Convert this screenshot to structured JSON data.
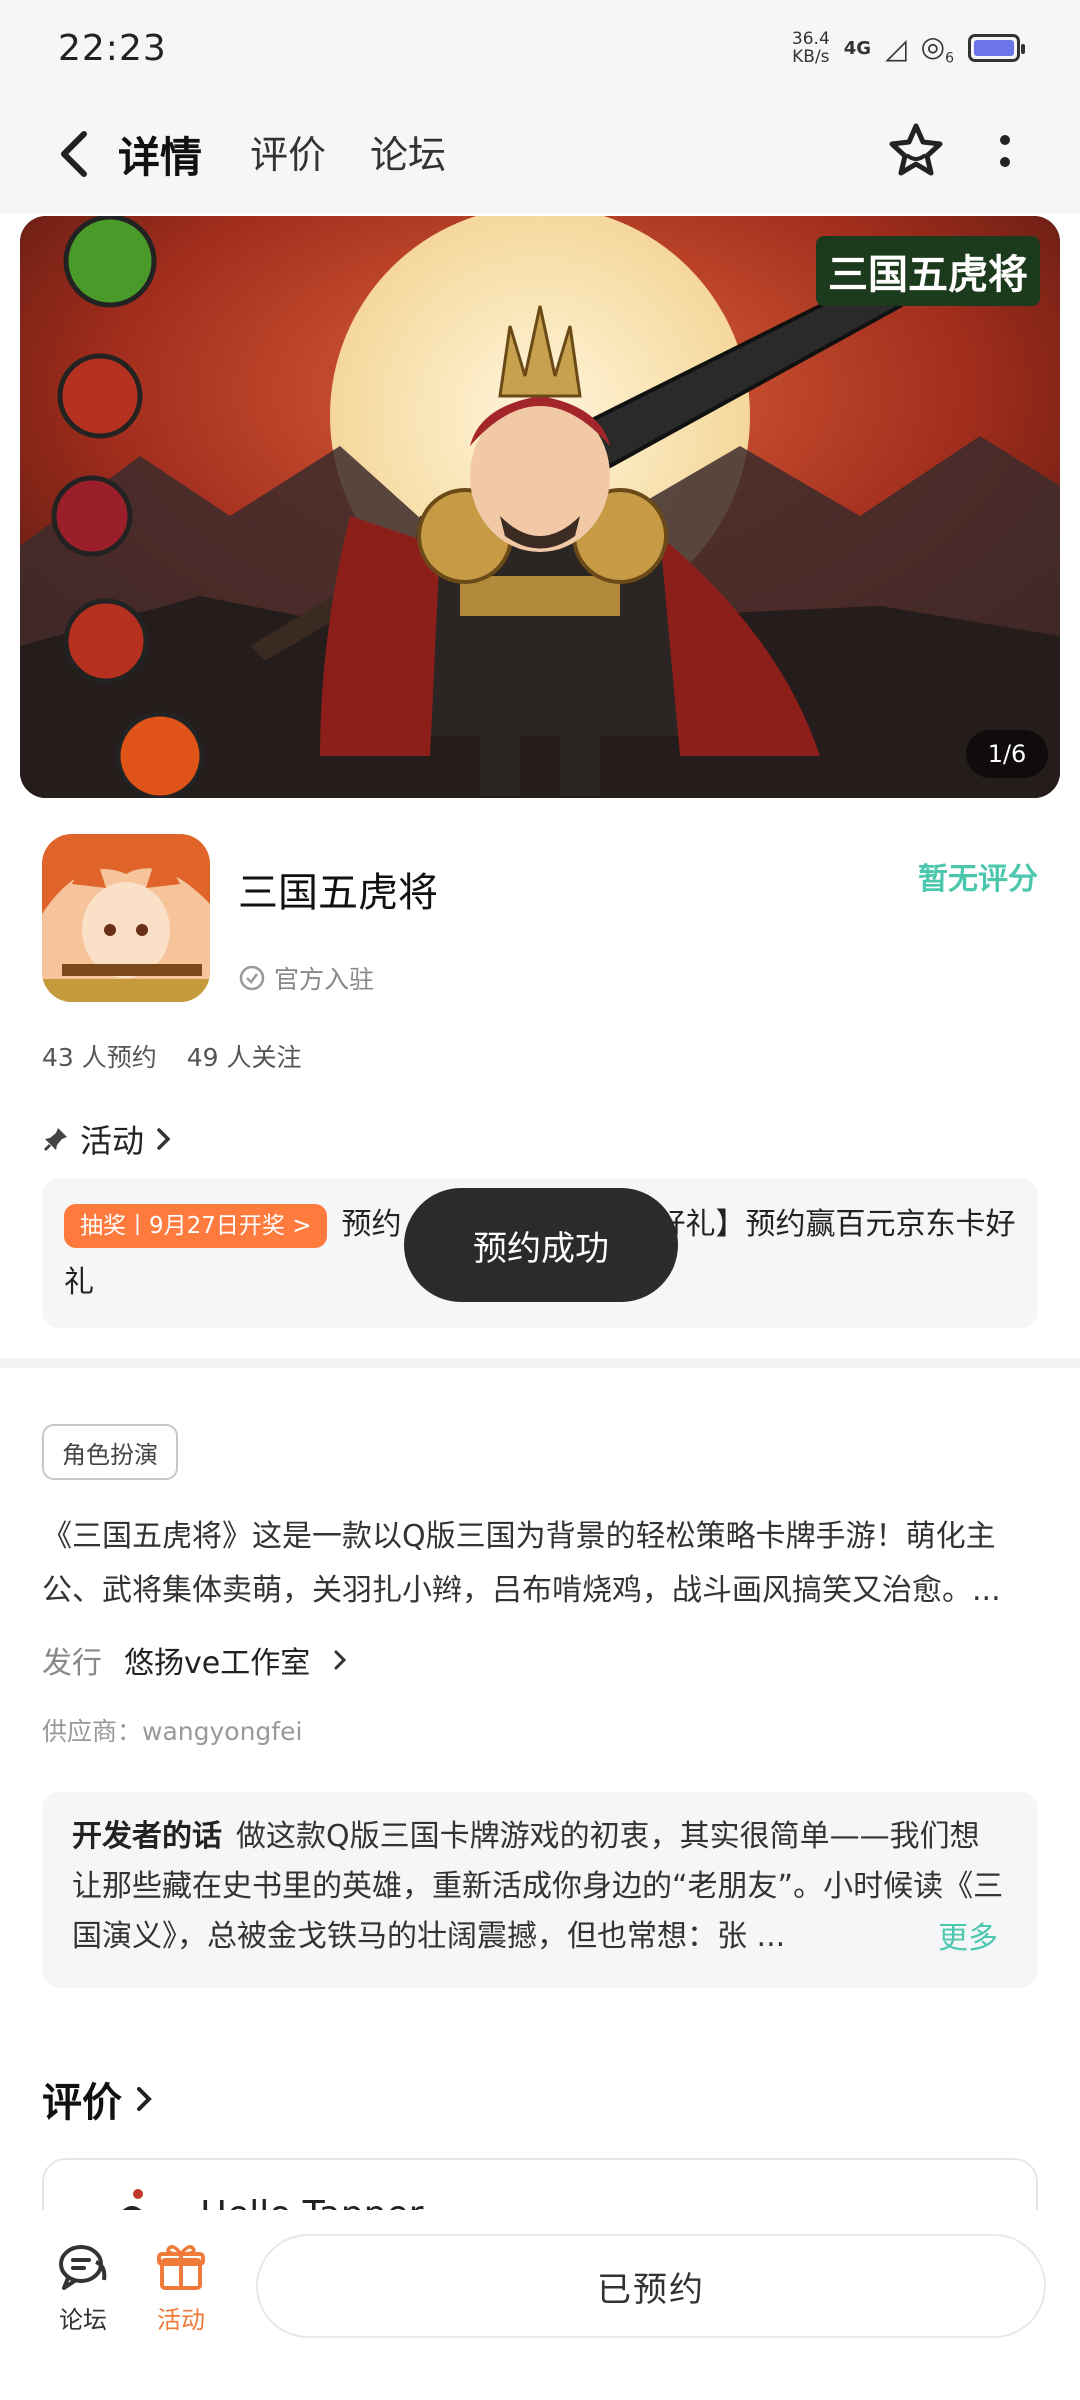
{
  "status_bar": {
    "time": "22:23",
    "net_speed_value": "36.4",
    "net_speed_unit": "KB/s",
    "network": "4G",
    "sim_slot": "6"
  },
  "nav": {
    "tabs": [
      "详情",
      "评价",
      "论坛"
    ],
    "active_tab": "详情",
    "accent_color": "#5ad0b8",
    "icons": [
      "back-icon",
      "star-icon",
      "more-icon"
    ]
  },
  "banner": {
    "overlay_title": "三国五虎将",
    "counter": "1/6"
  },
  "game": {
    "title": "三国五虎将",
    "official_label": "官方入驻",
    "rating": "暂无评分",
    "reservations": "43 人预约",
    "followers": "49 人关注"
  },
  "activity": {
    "heading": "活动",
    "badge": "抽奖丨9月27日开奖 >",
    "text_before_toast": "预约",
    "text_after_toast": "预约好礼】预约赢百元京东卡好礼",
    "badge_color": "#ff7a3d"
  },
  "toast": {
    "text": "预约成功"
  },
  "details": {
    "genre_tag": "角色扮演",
    "description": "《三国五虎将》这是一款以Q版三国为背景的轻松策略卡牌手游！萌化主公、武将集体卖萌，关羽扎小辫，吕布啃烧鸡，战斗画风搞笑又治愈。...",
    "publisher_label": "发行",
    "publisher_name": "悠扬ve工作室",
    "supplier": "供应商：wangyongfei"
  },
  "developer_note": {
    "label": "开发者的话",
    "text": "做这款Q版三国卡牌游戏的初衷，其实很简单——我们想让那些藏在史书里的英雄，重新活成你身边的“老朋友”。小时候读《三国演义》，总被金戈铁马的壮阔震撼，但也常想：张 ...",
    "more": "更多"
  },
  "reviews": {
    "heading": "评价",
    "first_preview": "Hello Tapper"
  },
  "bottom_bar": {
    "forum_label": "论坛",
    "activity_label": "活动",
    "reserved_button": "已预约",
    "activity_color": "#f07a3a"
  }
}
